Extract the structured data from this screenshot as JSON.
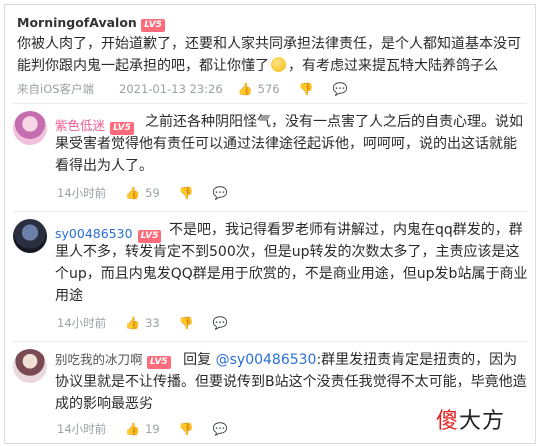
{
  "top_comment": {
    "username": "MorningofAvalon",
    "level": "LV5",
    "text_1": "你被人肉了，开始道歉了，还要和人家共同承担法律责任，是个人都知道基本没可能判你跟内鬼一起承担的吧，都让你懂了",
    "text_2": "，有考虑过来提瓦特大陆养鸽子么",
    "source": "来自iOS客户端",
    "time": "2021-01-13 23:26",
    "likes": "576"
  },
  "replies": [
    {
      "username": "紫色低迷",
      "level": "LV5",
      "text": "之前还各种阴阳怪气，没有一点害了人之后的自责心理。说如果受害者觉得他有责任可以通过法律途径起诉他，呵呵呵，说的出这话就能看得出为人了。",
      "time": "14小时前",
      "likes": "59"
    },
    {
      "username": "sy00486530",
      "level": "LV5",
      "text": "不是吧，我记得看罗老师有讲解过，内鬼在qq群发的，群里人不多，转发肯定不到500次，但是up转发的次数太多了，主责应该是这个up，而且内鬼发QQ群是用于欣赏的，不是商业用途，但up发b站属于商业用途",
      "time": "14小时前",
      "likes": "33"
    },
    {
      "username": "别吃我的冰刀啊",
      "level": "LV5",
      "reply_prefix": "回复",
      "mention": "@sy00486530",
      "text": ":群里发扭责肯定是扭责的，因为协议里就是不让传播。但要说传到B站这个没责任我觉得不太可能，毕竟他造成的影响最恶劣",
      "time": "14小时前",
      "likes": "19"
    }
  ],
  "watermark": {
    "red": "傻",
    "black": "大方"
  },
  "colors": {
    "pink_name": "#f25d8e",
    "blue_name": "#2a6fd6",
    "level_badge": "#ff6b7a",
    "meta_gray": "#9aa0a6"
  },
  "icons": {
    "like": "thumbs-up-icon",
    "dislike": "thumbs-down-icon",
    "reply": "reply-icon"
  }
}
